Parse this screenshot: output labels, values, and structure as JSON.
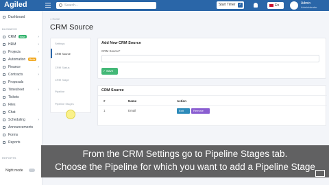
{
  "app": {
    "logo": "Agiled"
  },
  "topbar": {
    "search_placeholder": "Search...",
    "start_timer": "Start Timer",
    "language": "En",
    "user_name": "Admin",
    "user_role": "Administrator"
  },
  "sidebar": {
    "items": [
      {
        "label": "Dashboard",
        "icon": "home-icon"
      },
      {
        "section": "BUSINESS"
      },
      {
        "label": "CRM",
        "icon": "crm-icon",
        "badge": "New"
      },
      {
        "label": "HRM",
        "icon": "hrm-icon"
      },
      {
        "label": "Projects",
        "icon": "projects-icon"
      },
      {
        "label": "Automation",
        "icon": "automation-icon",
        "badge": "Beta"
      },
      {
        "label": "Finance",
        "icon": "finance-icon"
      },
      {
        "label": "Contracts",
        "icon": "contracts-icon"
      },
      {
        "label": "Proposals",
        "icon": "proposals-icon"
      },
      {
        "label": "Timesheet",
        "icon": "timesheet-icon"
      },
      {
        "label": "Tickets",
        "icon": "tickets-icon"
      },
      {
        "label": "Files",
        "icon": "files-icon"
      },
      {
        "label": "Chat",
        "icon": "chat-icon"
      },
      {
        "label": "Scheduling",
        "icon": "scheduling-icon"
      },
      {
        "label": "Announcements",
        "icon": "announcements-icon"
      },
      {
        "label": "Forms",
        "icon": "forms-icon"
      },
      {
        "label": "Reports",
        "icon": "reports-icon"
      }
    ],
    "reports_section": "REPORTS",
    "night_mode": "Night mode"
  },
  "breadcrumb": "Home",
  "page_title": "CRM Source",
  "settings_menu": [
    "Settings",
    "CRM Source",
    "CRM Status",
    "CRM Stage",
    "Pipeline",
    "Pipeline Stages"
  ],
  "add_panel": {
    "title": "Add New CRM Source",
    "field_label": "CRM Source*",
    "save_label": "Save"
  },
  "source_panel": {
    "title": "CRM Source",
    "headers": [
      "#",
      "Name",
      "Action"
    ],
    "rows": [
      {
        "num": "1",
        "name": "Email"
      }
    ],
    "edit_label": "Edit",
    "remove_label": "Remove"
  },
  "caption": {
    "line1": "From the CRM Settings go to Pipeline Stages tab.",
    "line2": "Choose the Pipeline for which you want to add a Pipeline Stage"
  },
  "colors": {
    "brand": "#2a66a8",
    "save": "#43b877",
    "edit": "#2d8bba",
    "remove": "#8a5ed1"
  }
}
